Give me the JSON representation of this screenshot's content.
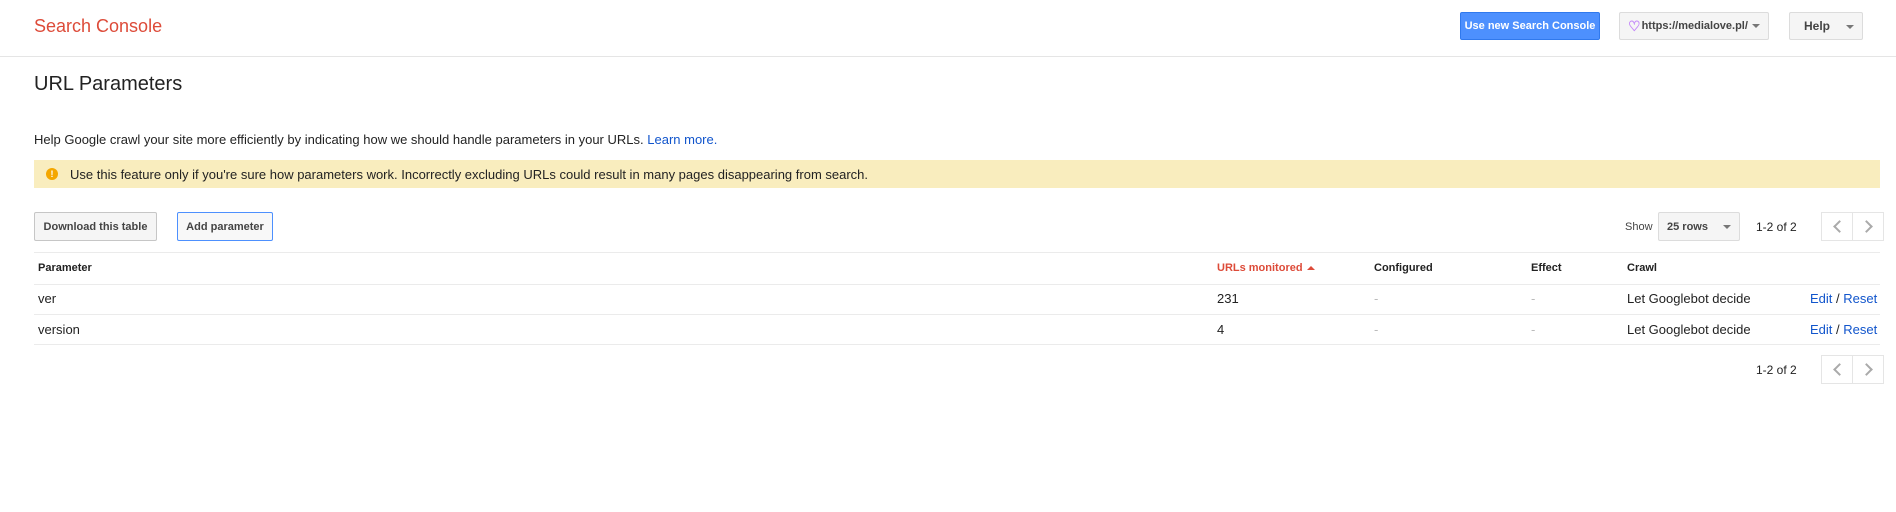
{
  "header": {
    "logo": "Search Console",
    "new_console_button": "Use new Search Console",
    "site": "https://medialove.pl/",
    "help": "Help"
  },
  "page": {
    "title": "URL Parameters",
    "intro": "Help Google crawl your site more efficiently by indicating how we should handle parameters in your URLs.",
    "learn_more": "Learn more.",
    "warning": "Use this feature only if you're sure how parameters work. Incorrectly excluding URLs could result in many pages disappearing from search."
  },
  "toolbar": {
    "download": "Download this table",
    "add": "Add parameter",
    "show_label": "Show",
    "rows": "25 rows",
    "pager": "1-2 of 2"
  },
  "table": {
    "headers": {
      "parameter": "Parameter",
      "urls": "URLs monitored",
      "configured": "Configured",
      "effect": "Effect",
      "crawl": "Crawl"
    },
    "rows": [
      {
        "parameter": "ver",
        "urls": "231",
        "configured": "-",
        "effect": "-",
        "crawl": "Let Googlebot decide",
        "edit": "Edit",
        "sep": "/",
        "reset": "Reset"
      },
      {
        "parameter": "version",
        "urls": "4",
        "configured": "-",
        "effect": "-",
        "crawl": "Let Googlebot decide",
        "edit": "Edit",
        "sep": "/",
        "reset": "Reset"
      }
    ]
  },
  "footer": {
    "pager": "1-2 of 2"
  },
  "colors": {
    "brand": "#dd4b39",
    "primary_button": "#4d90fe",
    "link": "#1155cc",
    "warning_bg": "#f9edbe"
  }
}
